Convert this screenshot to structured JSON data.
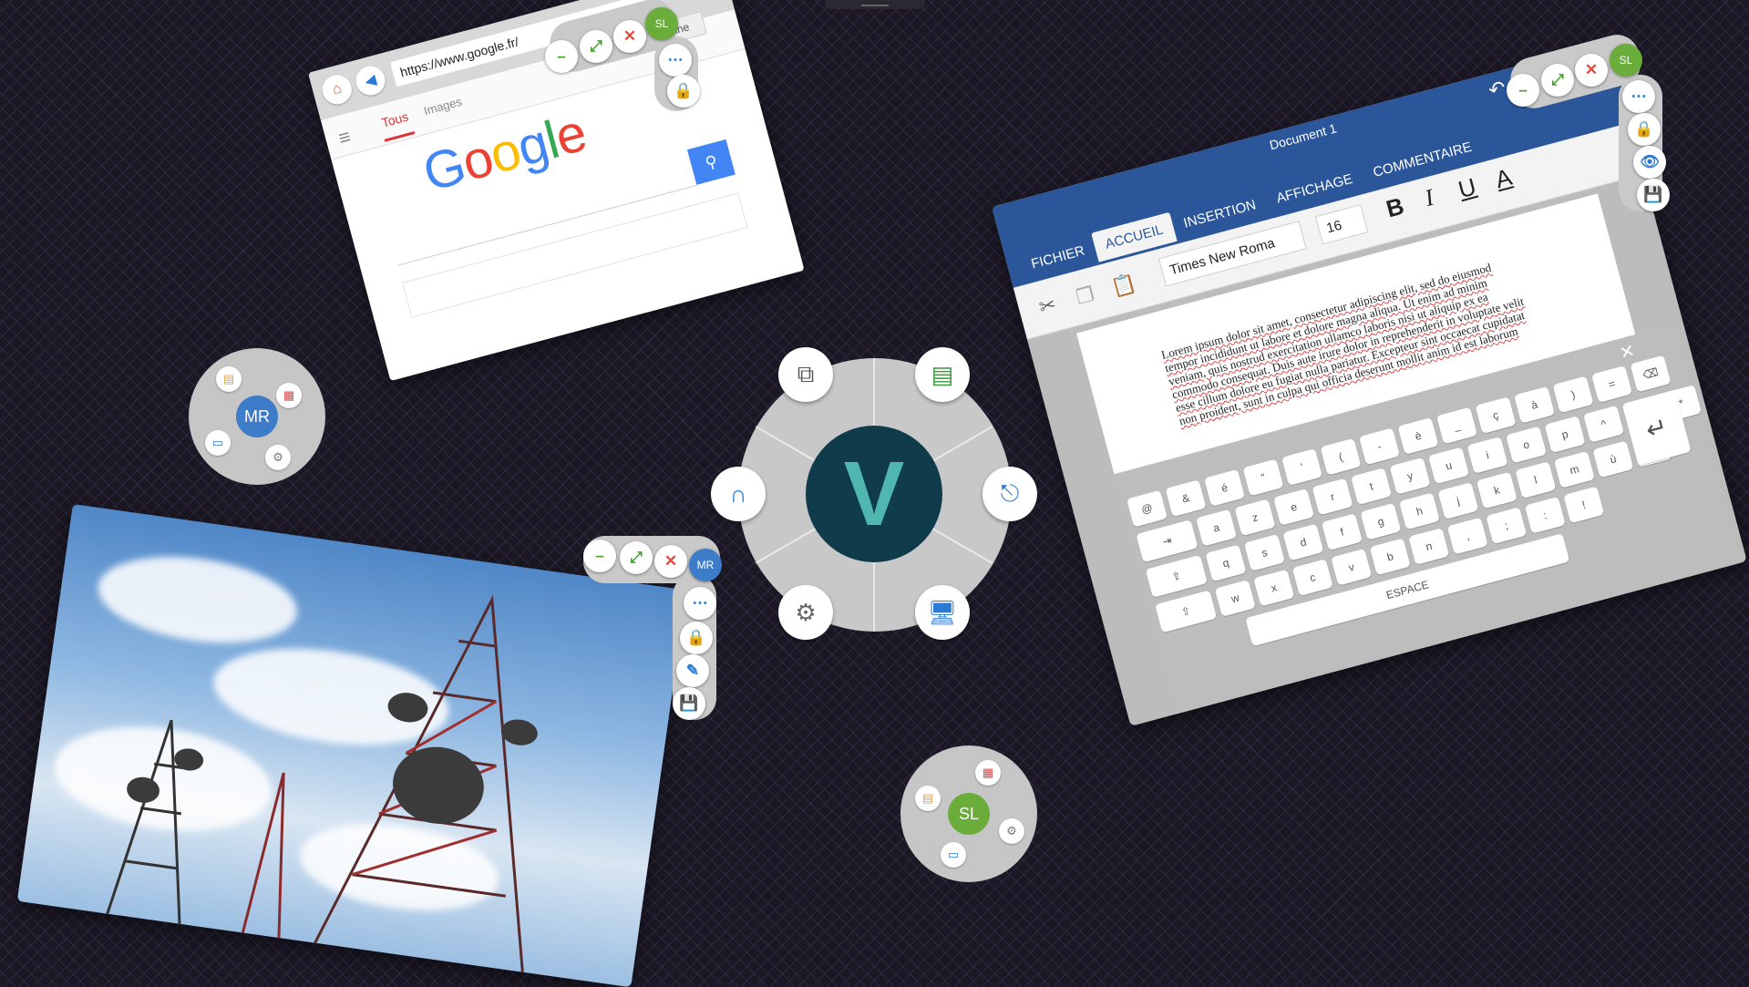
{
  "colors": {
    "accent_blue": "#2b579a",
    "green": "#6aad3b",
    "mr_blue": "#3d7cc9",
    "close_red": "#e14a3c",
    "brand_teal": "#4fb7b0"
  },
  "browser": {
    "url": "https://www.google.fr/",
    "user_button": "+Antoine",
    "tab_all": "Tous",
    "tab_images": "Images",
    "logo_letters": [
      "G",
      "o",
      "o",
      "g",
      "l",
      "e"
    ],
    "owner_badge": "SL"
  },
  "word": {
    "title": "Document 1",
    "tabs": [
      "FICHIER",
      "ACCUEIL",
      "INSERTION",
      "AFFICHAGE",
      "COMMENTAIRE"
    ],
    "font_name": "Times New Roma",
    "font_size": "16",
    "format_buttons": [
      "B",
      "I",
      "U",
      "A"
    ],
    "body_text": "Lorem ipsum dolor sit amet, consectetur adipiscing elit, sed do eiusmod tempor incididunt ut labore et dolore magna aliqua. Ut enim ad minim veniam, quis nostrud exercitation ullamco laboris nisi ut aliquip ex ea commodo consequat. Duis aute irure dolor in reprehenderit in voluptate velit esse cillum dolore eu fugiat nulla pariatur. Excepteur sint occaecat cupidatat non proident, sunt in culpa qui officia deserunt mollit anim id est laborum",
    "owner_badge": "SL",
    "keyboard": {
      "row1": [
        "@",
        "&",
        "é",
        "\"",
        "'",
        "(",
        "-",
        "è",
        "_",
        "ç",
        "à",
        ")",
        "=",
        "⌫"
      ],
      "row2": [
        "⇥",
        "a",
        "z",
        "e",
        "r",
        "t",
        "y",
        "u",
        "i",
        "o",
        "p",
        "^",
        "$",
        "*"
      ],
      "row3": [
        "⇪",
        "q",
        "s",
        "d",
        "f",
        "g",
        "h",
        "j",
        "k",
        "l",
        "m",
        "ù",
        "!"
      ],
      "row4": [
        "⇧",
        "w",
        "x",
        "c",
        "v",
        "b",
        "n",
        ",",
        ";",
        ":",
        "!"
      ],
      "space": "ESPACE",
      "enter": "↵"
    }
  },
  "photo": {
    "owner_badge": "MR"
  },
  "menus": {
    "user_left": "MR",
    "user_bottom": "SL"
  }
}
